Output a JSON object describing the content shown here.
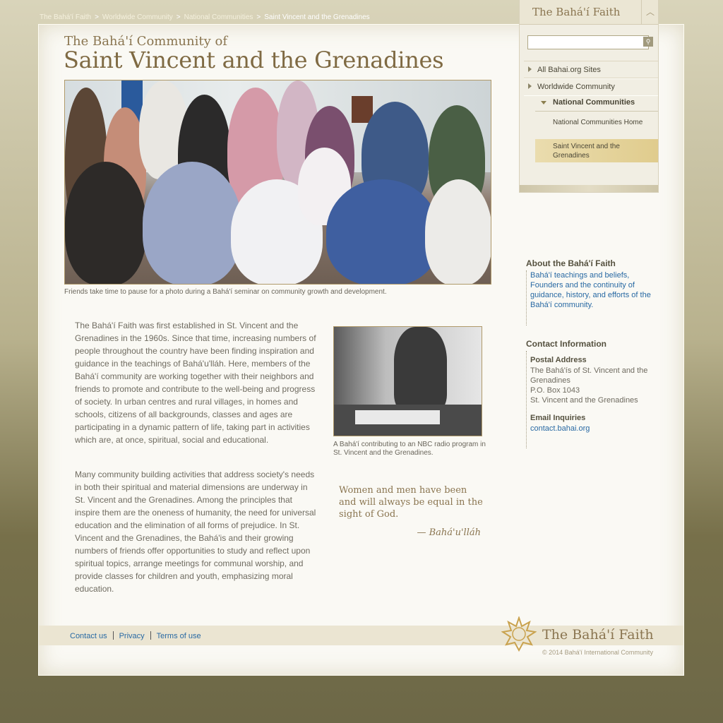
{
  "breadcrumb": {
    "items": [
      "The Bahá'í Faith",
      "Worldwide Community",
      "National Communities",
      "Saint Vincent and the Grenadines"
    ],
    "separator": ">"
  },
  "header": {
    "pre_title": "The Bahá'í Community of",
    "title": "Saint Vincent and the Grenadines"
  },
  "main": {
    "photo_caption": "Friends take time to pause for a photo during a Bahá'í seminar on community growth and development.",
    "paragraphs": [
      "The Bahá'í Faith was first established in St. Vincent and the Grenadines in the 1960s. Since that time, increasing numbers of people throughout the country have been finding inspiration and guidance in the teachings of Bahá'u'lláh. Here, members of the Bahá'í community are working together with their neighbors and friends to promote and contribute to the well-being and progress of society. In urban centres and rural villages, in homes and schools, citizens of all backgrounds, classes and ages are participating in a dynamic pattern of life, taking part in activities which are, at once, spiritual, social and educational.",
      "Many community building activities that address society's needs in both their spiritual and material dimensions are underway in St. Vincent and the Grenadines. Among the principles that inspire them are the oneness of humanity, the need for universal education and the elimination of all forms of prejudice. In St. Vincent and the Grenadines, the Bahá'is and their growing numbers of friends offer opportunities to study and reflect upon spiritual topics, arrange meetings for communal worship, and provide classes for children and youth, emphasizing moral education."
    ],
    "radio_caption": "A Bahá'í contributing to an NBC radio program in St. Vincent and the Grenadines.",
    "quote": "Women and men have been and will always be equal in the sight of God.",
    "quote_author": "— Bahá'u'lláh"
  },
  "nav": {
    "brand": "The Bahá'í Faith",
    "collapse_icon": "chevron-up-icon",
    "search_placeholder": "",
    "items": [
      "All Bahai.org Sites",
      "Worldwide Community"
    ],
    "section": "National Communities",
    "leaves": [
      "National Communities Home",
      "Saint Vincent and the Grenadines"
    ]
  },
  "sidebar": {
    "about_title": "About the Bahá'í Faith",
    "about_link": "Bahá'í teachings and beliefs, Founders and the continuity of guidance, history, and efforts of the Bahá'í community.",
    "contact_title": "Contact Information",
    "postal_label": "Postal Address",
    "postal_lines": [
      "The Bahá'ís of St. Vincent and the",
      "Grenadines",
      "P.O. Box 1043",
      "St. Vincent and the Grenadines"
    ],
    "email_label": "Email Inquiries",
    "email_link": "contact.bahai.org"
  },
  "footer": {
    "links": [
      "Contact us",
      "Privacy",
      "Terms of use"
    ],
    "brand": "The Bahá'í Faith",
    "copyright": "© 2014 Bahá'í International Community"
  },
  "colors": {
    "accent": "#8a7550",
    "link": "#2869a3",
    "page_bg": "#faf9f4",
    "body_bg": "#b8b18d"
  }
}
